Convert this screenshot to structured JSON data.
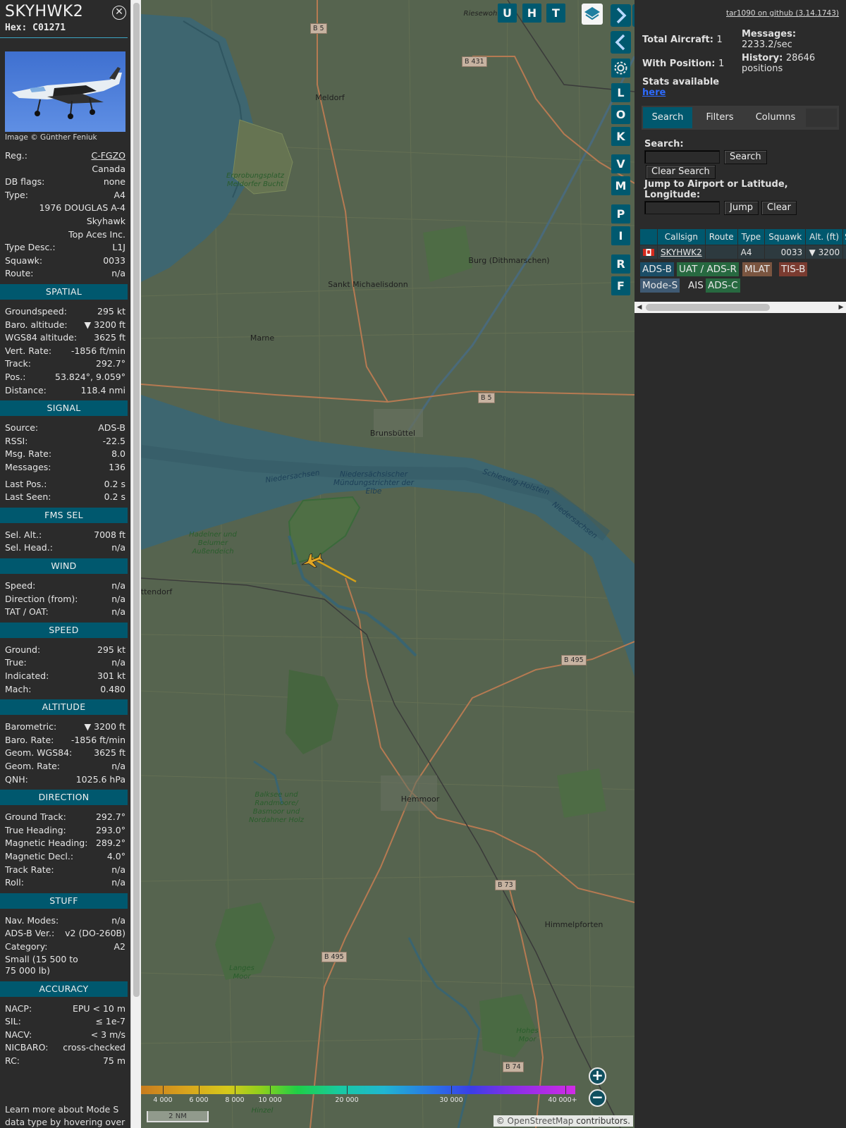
{
  "aircraft": {
    "callsign": "SKYHWK2",
    "hex_label": "Hex:",
    "hex": "C01271",
    "close_icon": "close-icon",
    "photo_credit": "Image © Günther Feniuk"
  },
  "details": [
    {
      "k": "Reg.:",
      "v": "C-FGZO"
    },
    {
      "k": "",
      "v": "Canada"
    },
    {
      "k": "DB flags:",
      "v": "none"
    },
    {
      "k": "Type:",
      "v": "A4"
    },
    {
      "k": "",
      "v": "1976 DOUGLAS A-4"
    },
    {
      "k": "",
      "v": "Skyhawk"
    },
    {
      "k": "",
      "v": "Top Aces Inc."
    },
    {
      "k": "Type Desc.:",
      "v": "L1J"
    },
    {
      "k": "Squawk:",
      "v": "0033"
    },
    {
      "k": "Route:",
      "v": "n/a"
    }
  ],
  "sections": {
    "spatial": {
      "title": "SPATIAL",
      "rows": [
        {
          "k": "Groundspeed:",
          "v": "295 kt"
        },
        {
          "k": "Baro. altitude:",
          "v": "▼ 3200 ft"
        },
        {
          "k": "WGS84 altitude:",
          "v": "3625 ft"
        },
        {
          "k": "Vert. Rate:",
          "v": "-1856 ft/min"
        },
        {
          "k": "Track:",
          "v": "292.7°"
        },
        {
          "k": "Pos.:",
          "v": "53.824°, 9.059°"
        },
        {
          "k": "Distance:",
          "v": "118.4 nmi"
        }
      ]
    },
    "signal": {
      "title": "SIGNAL",
      "rows": [
        {
          "k": "Source:",
          "v": "ADS-B"
        },
        {
          "k": "RSSI:",
          "v": "-22.5"
        },
        {
          "k": "Msg. Rate:",
          "v": "8.0"
        },
        {
          "k": "Messages:",
          "v": "136"
        },
        {
          "k": "Last Pos.:",
          "v": "0.2 s"
        },
        {
          "k": "Last Seen:",
          "v": "0.2 s"
        }
      ]
    },
    "fms": {
      "title": "FMS SEL",
      "rows": [
        {
          "k": "Sel. Alt.:",
          "v": "7008 ft"
        },
        {
          "k": "Sel. Head.:",
          "v": "n/a"
        }
      ]
    },
    "wind": {
      "title": "WIND",
      "rows": [
        {
          "k": "Speed:",
          "v": "n/a"
        },
        {
          "k": "Direction (from):",
          "v": "n/a"
        },
        {
          "k": "TAT / OAT:",
          "v": "n/a"
        }
      ]
    },
    "speed": {
      "title": "SPEED",
      "rows": [
        {
          "k": "Ground:",
          "v": "295 kt"
        },
        {
          "k": "True:",
          "v": "n/a"
        },
        {
          "k": "Indicated:",
          "v": "301 kt"
        },
        {
          "k": "Mach:",
          "v": "0.480"
        }
      ]
    },
    "altitude": {
      "title": "ALTITUDE",
      "rows": [
        {
          "k": "Barometric:",
          "v": "▼ 3200 ft"
        },
        {
          "k": "Baro. Rate:",
          "v": "-1856 ft/min"
        },
        {
          "k": "Geom. WGS84:",
          "v": "3625 ft"
        },
        {
          "k": "Geom. Rate:",
          "v": "n/a"
        },
        {
          "k": "QNH:",
          "v": "1025.6 hPa"
        }
      ]
    },
    "direction": {
      "title": "DIRECTION",
      "rows": [
        {
          "k": "Ground Track:",
          "v": "292.7°"
        },
        {
          "k": "True Heading:",
          "v": "293.0°"
        },
        {
          "k": "Magnetic Heading:",
          "v": "289.2°"
        },
        {
          "k": "Magnetic Decl.:",
          "v": "4.0°"
        },
        {
          "k": "Track Rate:",
          "v": "n/a"
        },
        {
          "k": "Roll:",
          "v": "n/a"
        }
      ]
    },
    "stuff": {
      "title": "STUFF",
      "rows": [
        {
          "k": "Nav. Modes:",
          "v": "n/a"
        },
        {
          "k": "ADS-B Ver.:",
          "v": "v2 (DO-260B)"
        },
        {
          "k": "Category:",
          "v": "A2"
        },
        {
          "k": "Small (15 500 to 75 000 lb)",
          "v": ""
        }
      ]
    },
    "accuracy": {
      "title": "ACCURACY",
      "rows": [
        {
          "k": "NACP:",
          "v": "EPU < 10 m"
        },
        {
          "k": "SIL:",
          "v": "≤ 1e-7"
        },
        {
          "k": "NACV:",
          "v": "< 3 m/s"
        },
        {
          "k": "NICBARO:",
          "v": "cross-checked"
        },
        {
          "k": "RC:",
          "v": "75 m"
        }
      ]
    }
  },
  "learn_more": "Learn more about Mode S data type by hovering over",
  "map": {
    "places": [
      {
        "name": "Meldorf"
      },
      {
        "name": "Sankt Michaelisdonn"
      },
      {
        "name": "Burg (Dithmarschen)"
      },
      {
        "name": "Marne"
      },
      {
        "name": "Brunsbüttel"
      },
      {
        "name": "Hemmoor"
      },
      {
        "name": "Himmelpforten"
      },
      {
        "name": "Riesewohld"
      },
      {
        "name": "ttendorf"
      }
    ],
    "water_labels": [
      "Niedersächsischer Mündungstrichter der Elbe",
      "Niedersachsen",
      "Schleswig-Holstein",
      "Niedersachsen"
    ],
    "nature_labels": [
      "Erprobungsplatz Meldorfer Bucht",
      "Hadelner und Belumer Außendeich",
      "Balksee und Randmoore/ Basmoor und Nordahner Holz",
      "Langes Moor",
      "Hohes Moor",
      "Hinzel"
    ],
    "roads": [
      "B 5",
      "B 431",
      "B 5",
      "B 495",
      "B 73",
      "B 495",
      "B 74"
    ],
    "buttons": [
      "U",
      "H",
      "T",
      "L",
      "O",
      "K",
      "V",
      "M",
      "P",
      "I",
      "R",
      "F"
    ],
    "altitude_legend": [
      "4 000",
      "6 000",
      "8 000",
      "10 000",
      "20 000",
      "30 000",
      "40 000+"
    ],
    "scale": "2 NM",
    "attribution_prefix": "© ",
    "attribution_link": "OpenStreetMap",
    "attribution_suffix": " contributors.",
    "aircraft_track_deg": 292.7
  },
  "right": {
    "github": "tar1090 on github (3.14.1743)",
    "total_label": "Total Aircraft:",
    "total": "1",
    "withpos_label": "With Position:",
    "withpos": "1",
    "messages_label": "Messages:",
    "messages": "2233.2/sec",
    "history_label": "History:",
    "history": "28646 positions",
    "stats_label": "Stats available",
    "stats_link": "here",
    "tabs": [
      "Search",
      "Filters",
      "Columns"
    ],
    "search_label": "Search:",
    "search_button": "Search",
    "clear_search": "Clear Search",
    "jump_label": "Jump to Airport or Latitude, Longitude:",
    "jump_button": "Jump",
    "clear_button": "Clear",
    "table_headers": [
      "",
      "Callsign",
      "Route",
      "Type",
      "Squawk",
      "Alt. (ft)",
      "Sp"
    ],
    "table_row": {
      "callsign": "SKYHWK2",
      "route": "",
      "type": "A4",
      "squawk": "0033",
      "alt": "▼ 3200"
    },
    "sources": [
      {
        "label": "ADS-B",
        "bg": "#1b4d66",
        "fg": "#e8e8e8"
      },
      {
        "label": "UAT / ADS-R",
        "bg": "#276940",
        "fg": "#e8e8e8"
      },
      {
        "label": "MLAT",
        "bg": "#7a5540",
        "fg": "#e8e8e8"
      },
      {
        "label": "TIS-B",
        "bg": "#7a3b30",
        "fg": "#e8e8e8"
      },
      {
        "label": "Mode-S",
        "bg": "#3f5a73",
        "fg": "#e8e8e8"
      },
      {
        "label": "AIS",
        "bg": "#2b2b2b",
        "fg": "#e8e8e8"
      },
      {
        "label": "ADS-C",
        "bg": "#276940",
        "fg": "#e8e8e8"
      }
    ]
  }
}
